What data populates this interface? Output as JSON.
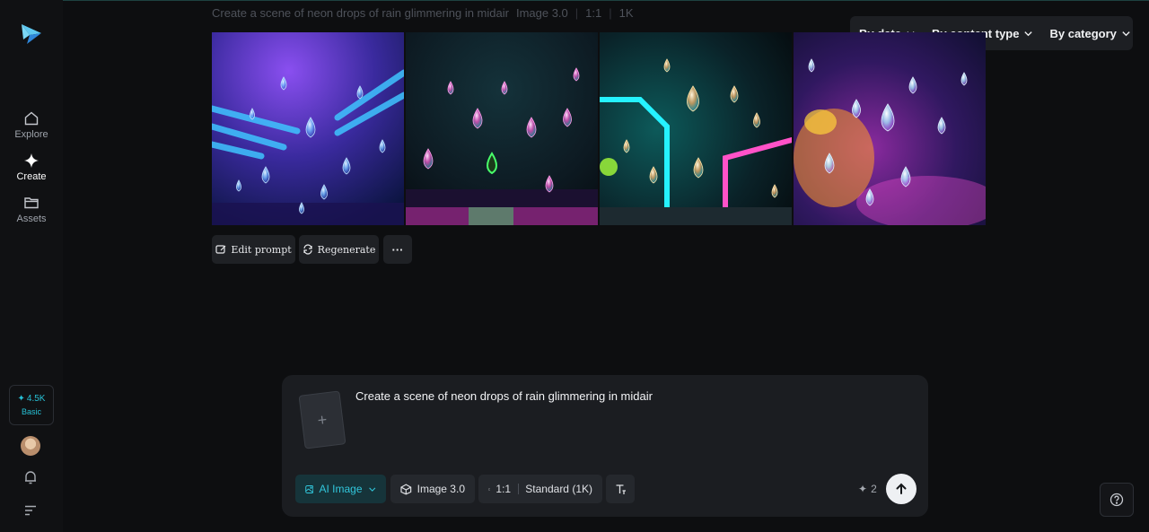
{
  "nav": {
    "items": [
      {
        "label": "Explore",
        "icon": "home-icon"
      },
      {
        "label": "Create",
        "icon": "sparkle-icon"
      },
      {
        "label": "Assets",
        "icon": "folder-icon"
      }
    ]
  },
  "credits": {
    "amount": "4.5K",
    "plan": "Basic",
    "accent": "#27c1d6"
  },
  "history": {
    "prompt": "Create a scene of neon drops of rain glimmering in midair",
    "model": "Image 3.0",
    "ratio": "1:1",
    "resolution": "1K"
  },
  "filters": {
    "date": "By date",
    "content_type": "By content type",
    "category": "By category"
  },
  "actions": {
    "edit": "Edit prompt",
    "regenerate": "Regenerate",
    "more": "···"
  },
  "composer": {
    "prompt": "Create a scene of neon drops of rain glimmering in midair",
    "mode": "AI Image",
    "model": "Image 3.0",
    "ratio": "1:1",
    "quality": "Standard (1K)",
    "cost": "2",
    "add_ref": "+"
  }
}
